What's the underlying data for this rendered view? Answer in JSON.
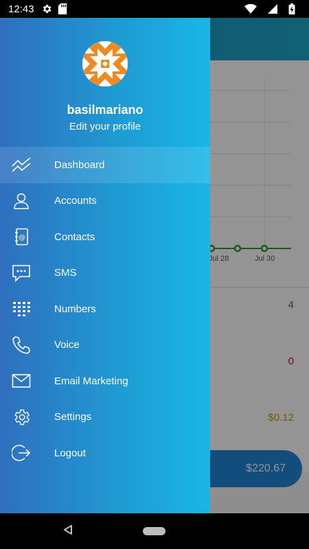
{
  "status_bar": {
    "time": "12:43",
    "icons": [
      "settings-gear-icon",
      "sd-card-icon",
      "wifi-icon",
      "signal-icon",
      "battery-charging-icon"
    ]
  },
  "background": {
    "chart_ticks": [
      "Jul 28",
      "Jul 30"
    ],
    "stats": [
      "4",
      "0",
      "$0.12"
    ],
    "balance": "$220.67",
    "colors": {
      "green": "#2a8a1a",
      "red": "#c0101a",
      "gold": "#c79a0a",
      "accent": "#1f86d6"
    }
  },
  "drawer": {
    "username": "basilmariano",
    "edit_profile": "Edit your profile",
    "gradient": [
      "#2f6fbe",
      "#18b6e6"
    ],
    "menu": [
      {
        "label": "Dashboard",
        "icon": "dashboard-trend-icon",
        "active": true
      },
      {
        "label": "Accounts",
        "icon": "person-icon"
      },
      {
        "label": "Contacts",
        "icon": "address-book-icon"
      },
      {
        "label": "SMS",
        "icon": "chat-bubble-icon"
      },
      {
        "label": "Numbers",
        "icon": "keypad-icon"
      },
      {
        "label": "Voice",
        "icon": "phone-icon"
      },
      {
        "label": "Email Marketing",
        "icon": "envelope-icon"
      },
      {
        "label": "Settings",
        "icon": "gear-icon"
      },
      {
        "label": "Logout",
        "icon": "logout-icon"
      }
    ]
  }
}
